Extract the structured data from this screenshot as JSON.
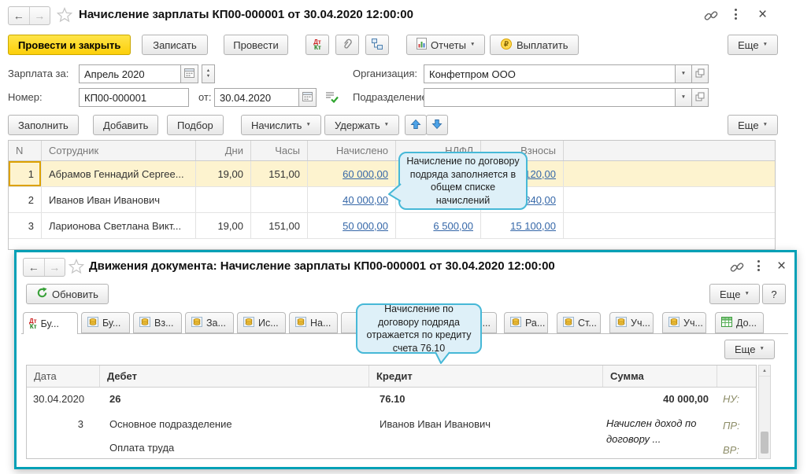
{
  "colors": {
    "primary_button": "#fccf0a",
    "window_border_teal": "#00a0b6",
    "link_blue": "#3567a8",
    "row_highlight": "#fdf3cf",
    "callout_bg": "#def0f8",
    "callout_border": "#46b8d7",
    "selected_cell_border": "#dca100"
  },
  "win1": {
    "title": "Начисление зарплаты КП00-000001 от 30.04.2020 12:00:00",
    "toolbar": {
      "post_close": "Провести и закрыть",
      "save": "Записать",
      "post": "Провести",
      "reports": "Отчеты",
      "pay": "Выплатить",
      "more": "Еще"
    },
    "fields": {
      "salary_for_label": "Зарплата за:",
      "salary_for_value": "Апрель 2020",
      "org_label": "Организация:",
      "org_value": "Конфетпром ООО",
      "number_label": "Номер:",
      "number_value": "КП00-000001",
      "date_prefix": "от:",
      "date_value": "30.04.2020",
      "department_label": "Подразделение:",
      "department_value": ""
    },
    "commandbar": {
      "fill": "Заполнить",
      "add": "Добавить",
      "pick": "Подбор",
      "accrue": "Начислить",
      "withhold": "Удержать",
      "more": "Еще"
    },
    "table": {
      "headers": {
        "n": "N",
        "employee": "Сотрудник",
        "days": "Дни",
        "hours": "Часы",
        "accrued": "Начислено",
        "ndfl": "НДФЛ",
        "contrib": "Взносы"
      },
      "rows": [
        {
          "n": "1",
          "employee": "Абрамов Геннадий Сергее...",
          "days": "19,00",
          "hours": "151,00",
          "accrued": "60 000,00",
          "ndfl": "",
          "contrib": "120,00"
        },
        {
          "n": "2",
          "employee": "Иванов Иван Иванович",
          "days": "",
          "hours": "",
          "accrued": "40 000,00",
          "ndfl": "",
          "contrib": "840,00"
        },
        {
          "n": "3",
          "employee": "Ларионова Светлана Викт...",
          "days": "19,00",
          "hours": "151,00",
          "accrued": "50 000,00",
          "ndfl": "6 500,00",
          "contrib": "15 100,00"
        }
      ]
    },
    "callout": "Начисление по договору подряда заполняется в общем списке начислений"
  },
  "win2": {
    "title": "Движения документа: Начисление зарплаты КП00-000001 от 30.04.2020 12:00:00",
    "toolbar": {
      "refresh": "Обновить",
      "more": "Еще",
      "help": "?"
    },
    "tabs": [
      "Бу...",
      "Бу...",
      "Вз...",
      "За...",
      "Ис...",
      "На...",
      "",
      "",
      "...",
      "Ра...",
      "Ст...",
      "Уч...",
      "Уч...",
      "До..."
    ],
    "more2": "Еще",
    "callout": "Начисление по договору подряда отражается по кредиту счета 76.10",
    "table": {
      "headers": {
        "date": "Дата",
        "debit": "Дебет",
        "credit": "Кредит",
        "sum": "Сумма"
      },
      "entry": {
        "date": "30.04.2020",
        "line_no": "3",
        "debit_account": "26",
        "debit_sub1": "Основное подразделение",
        "debit_sub2": "Оплата труда",
        "credit_account": "76.10",
        "credit_sub1": "Иванов Иван Иванович",
        "amount": "40 000,00",
        "comment": "Начислен доход по договору ...",
        "nu_label": "НУ:",
        "pr_label": "ПР:",
        "vr_label": "ВР:"
      }
    }
  }
}
